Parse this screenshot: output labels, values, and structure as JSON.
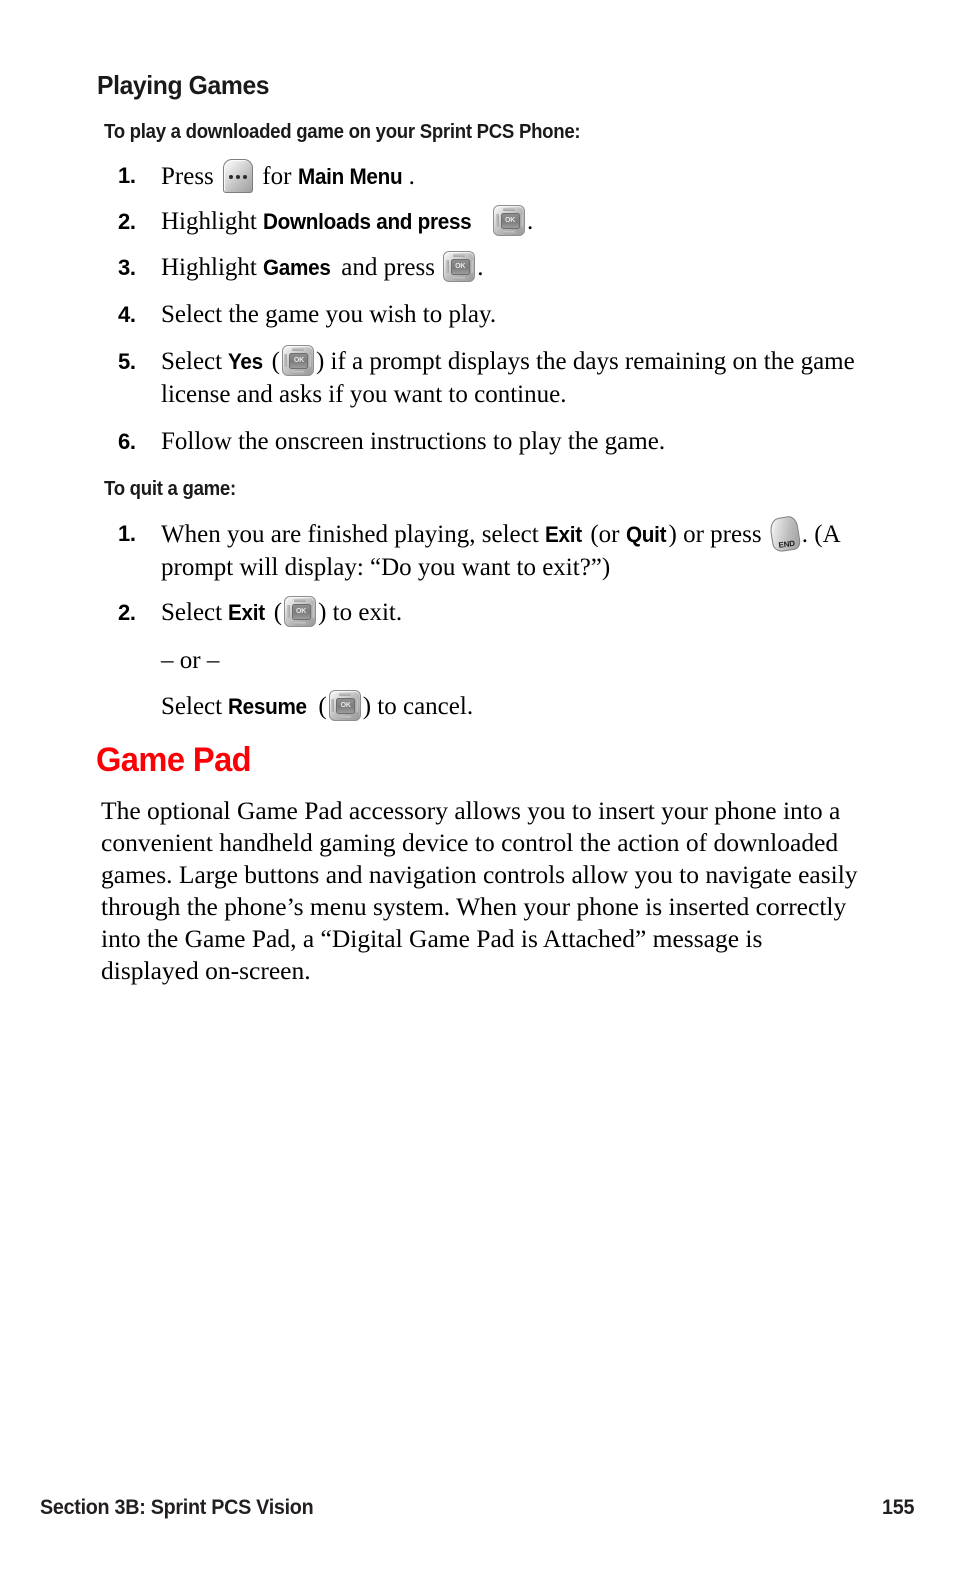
{
  "page": {
    "section_heading": "Playing Games",
    "chapter_heading": "Game Pad",
    "accent_color": "#fb0005",
    "text_color": "#000000",
    "background_color": "#ffffff"
  },
  "play_section": {
    "subheading": "To play a downloaded game on your Sprint PCS Phone:",
    "steps": [
      {
        "number": "1.",
        "parts": [
          {
            "type": "text",
            "value": "Press "
          },
          {
            "type": "icon",
            "icon": "main-menu-key",
            "label": ""
          },
          {
            "type": "text",
            "value": " for "
          },
          {
            "type": "bold",
            "value": "Main Menu"
          },
          {
            "type": "text",
            "value": "."
          }
        ]
      },
      {
        "number": "2.",
        "parts": [
          {
            "type": "text",
            "value": "Highlight "
          },
          {
            "type": "bold",
            "value": "Downloads and press"
          },
          {
            "type": "text",
            "value": " "
          },
          {
            "type": "icon",
            "icon": "ok-key",
            "label": "OK"
          },
          {
            "type": "text",
            "value": "."
          }
        ]
      },
      {
        "number": "3.",
        "parts": [
          {
            "type": "text",
            "value": "Highlight "
          },
          {
            "type": "bold",
            "value": "Games"
          },
          {
            "type": "text",
            "value": " and press "
          },
          {
            "type": "icon",
            "icon": "ok-key",
            "label": "OK"
          },
          {
            "type": "text",
            "value": "."
          }
        ]
      },
      {
        "number": "4.",
        "parts": [
          {
            "type": "text",
            "value": "Select the game you wish to play."
          }
        ]
      },
      {
        "number": "5.",
        "parts": [
          {
            "type": "text",
            "value": "Select "
          },
          {
            "type": "bold",
            "value": "Yes"
          },
          {
            "type": "text",
            "value": " ("
          },
          {
            "type": "icon",
            "icon": "ok-key",
            "label": "OK"
          },
          {
            "type": "text",
            "value": ") if a prompt displays the days remaining on the game license and asks if you want to continue."
          }
        ]
      },
      {
        "number": "6.",
        "parts": [
          {
            "type": "text",
            "value": "Follow the onscreen instructions to play the game."
          }
        ]
      }
    ]
  },
  "quit_section": {
    "subheading": "To quit a game:",
    "steps": [
      {
        "number": "1.",
        "parts": [
          {
            "type": "text",
            "value": "When you are finished playing, select "
          },
          {
            "type": "bold",
            "value": "Exit"
          },
          {
            "type": "text",
            "value": " (or "
          },
          {
            "type": "bold",
            "value": "Quit"
          },
          {
            "type": "text",
            "value": ") or press "
          },
          {
            "type": "icon",
            "icon": "end-key",
            "label": "END"
          },
          {
            "type": "text",
            "value": ". (A prompt will display: “Do you want to exit?”)"
          }
        ]
      },
      {
        "number": "2.",
        "parts": [
          {
            "type": "text",
            "value": "Select "
          },
          {
            "type": "bold",
            "value": "Exit"
          },
          {
            "type": "text",
            "value": " ("
          },
          {
            "type": "icon",
            "icon": "ok-key",
            "label": "OK"
          },
          {
            "type": "text",
            "value": ") to exit."
          }
        ]
      }
    ],
    "or_separator": "– or –",
    "alternate": {
      "parts": [
        {
          "type": "text",
          "value": "Select "
        },
        {
          "type": "bold",
          "value": "Resume"
        },
        {
          "type": "text",
          "value": " ("
        },
        {
          "type": "icon",
          "icon": "ok-key",
          "label": "OK"
        },
        {
          "type": "text",
          "value": ") to cancel."
        }
      ]
    }
  },
  "game_pad_section": {
    "body": "The optional Game Pad accessory allows you to insert your phone into a convenient handheld gaming device to control the action of downloaded games. Large buttons and navigation controls allow you to navigate easily through the phone’s menu system. When your phone is inserted correctly into the Game Pad, a “Digital Game Pad is Attached” message is displayed on-screen."
  },
  "footer": {
    "left": "Section 3B: Sprint PCS Vision",
    "page_number": "155"
  }
}
